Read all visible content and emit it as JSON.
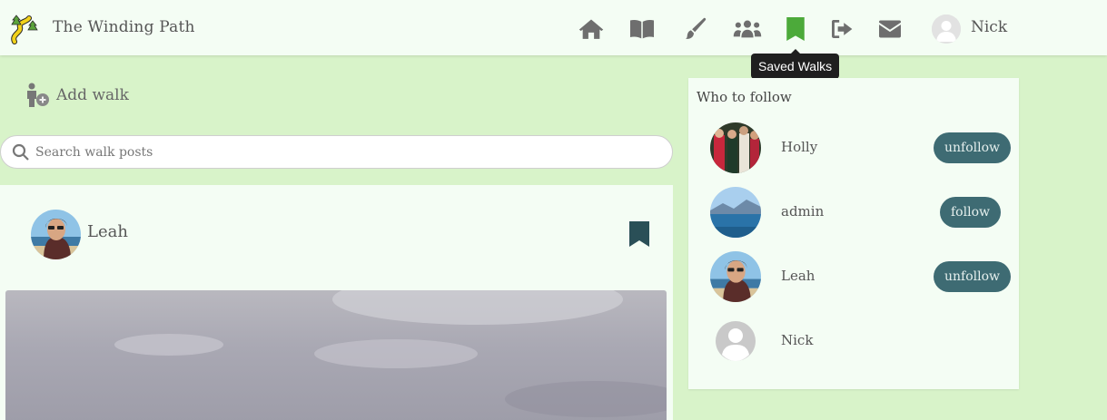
{
  "header": {
    "brand": "The Winding Path",
    "logo_icon": "winding-path-logo",
    "nav": [
      {
        "icon": "home-icon",
        "label": "Home"
      },
      {
        "icon": "book-icon",
        "label": "Walks"
      },
      {
        "icon": "paintbrush-icon",
        "label": "Create"
      },
      {
        "icon": "users-icon",
        "label": "Community"
      },
      {
        "icon": "bookmark-icon",
        "label": "Saved Walks",
        "active": true
      },
      {
        "icon": "sign-out-icon",
        "label": "Log out"
      },
      {
        "icon": "envelope-icon",
        "label": "Messages"
      }
    ],
    "user_name": "Nick",
    "tooltip": "Saved Walks",
    "active_color": "#4caa3a",
    "icon_color": "#6e6e6e"
  },
  "add_walk": {
    "label": "Add walk",
    "icon": "add-person-icon"
  },
  "search": {
    "placeholder": "Search walk posts",
    "value": "",
    "icon": "search-icon"
  },
  "post": {
    "author": "Leah",
    "bookmark_icon": "bookmark-icon"
  },
  "who_to_follow": {
    "title": "Who to follow",
    "users": [
      {
        "name": "Holly",
        "action": "unfollow"
      },
      {
        "name": "admin",
        "action": "follow"
      },
      {
        "name": "Leah",
        "action": "unfollow"
      },
      {
        "name": "Nick",
        "action": ""
      }
    ],
    "button_color": "#3e6b73"
  },
  "colors": {
    "page_background": "#d8f3c9",
    "card_background": "#f4fdf4"
  }
}
